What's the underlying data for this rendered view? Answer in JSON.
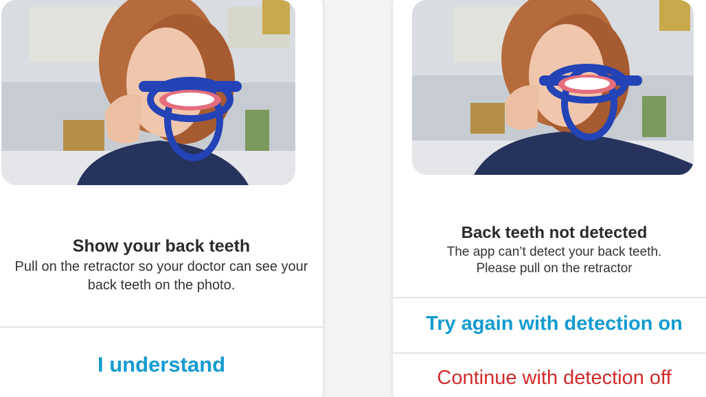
{
  "colors": {
    "accent_blue": "#149bd1",
    "danger_red": "#d22a2a",
    "title_dark": "#2b2b2b",
    "retractor_blue": "#2343b6"
  },
  "left_card": {
    "title": "Show your back teeth",
    "body": "Pull on the retractor so your doctor can see your back teeth on the photo.",
    "action_label": "I understand"
  },
  "right_card": {
    "title": "Back teeth not detected",
    "body_line1": "The app can’t detect your back teeth.",
    "body_line2": "Please pull on the retractor",
    "primary_action_label": "Try again with detection on",
    "secondary_action_label": "Continue with detection off"
  }
}
